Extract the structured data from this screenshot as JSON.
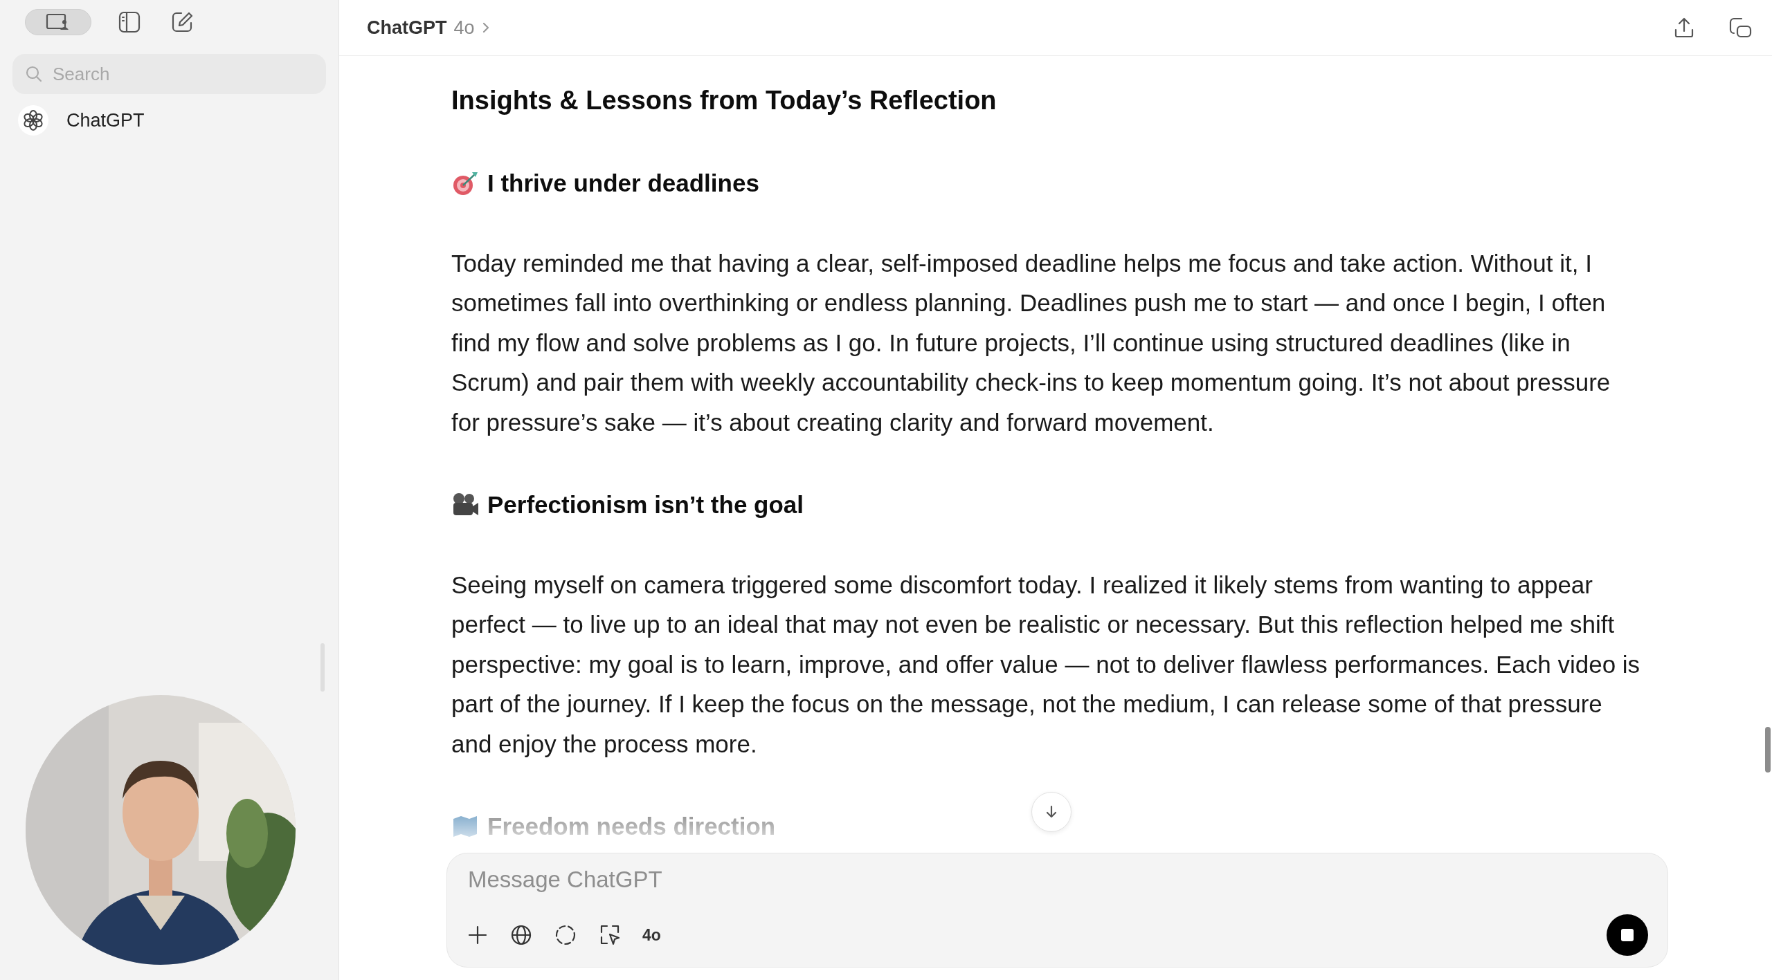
{
  "sidebar": {
    "search": {
      "placeholder": "Search"
    },
    "items": [
      {
        "label": "ChatGPT"
      }
    ]
  },
  "header": {
    "title": "ChatGPT",
    "model": "4o"
  },
  "article": {
    "title": "Insights & Lessons from Today’s Reflection",
    "sections": [
      {
        "kind": "target",
        "heading": "I thrive under deadlines",
        "faded": false,
        "paragraph": "Today reminded me that having a clear, self-imposed deadline helps me focus and take action. Without it, I sometimes fall into overthinking or endless planning. Deadlines push me to start — and once I begin, I often find my flow and solve problems as I go. In future projects, I’ll continue using structured deadlines (like in Scrum) and pair them with weekly accountability check-ins to keep momentum going. It’s not about pressure for pressure’s sake — it’s about creating clarity and forward movement."
      },
      {
        "kind": "camera",
        "heading": "Perfectionism isn’t the goal",
        "faded": false,
        "paragraph": "Seeing myself on camera triggered some discomfort today. I realized it likely stems from wanting to appear perfect — to live up to an ideal that may not even be realistic or necessary. But this reflection helped me shift perspective: my goal is to learn, improve, and offer value — not to deliver flawless performances. Each video is part of the journey. If I keep the focus on the message, not the medium, I can release some of that pressure and enjoy the process more."
      },
      {
        "kind": "map",
        "heading": "Freedom needs direction",
        "faded": true
      }
    ]
  },
  "composer": {
    "placeholder": "Message ChatGPT",
    "model": "4o"
  }
}
